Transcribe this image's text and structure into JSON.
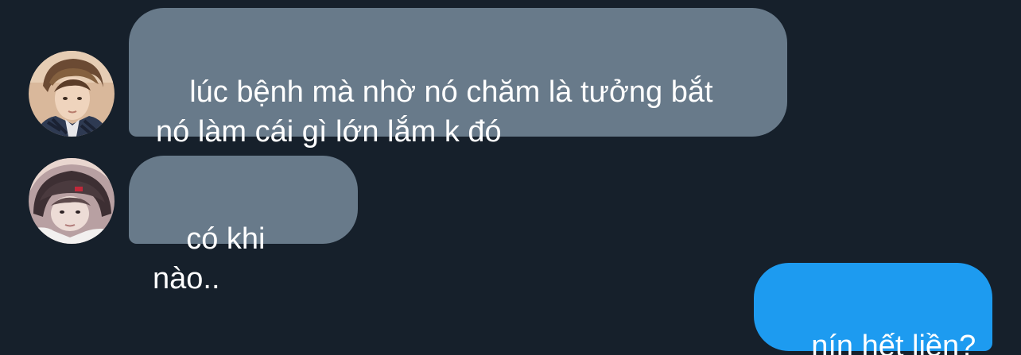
{
  "conversation": {
    "messages": [
      {
        "direction": "incoming",
        "avatar_icon": "avatar-photo-person-fluffy-hair",
        "text": "lúc bệnh mà nhờ nó chăm là tưởng bắt\nnó làm cái gì lớn lắm k đó"
      },
      {
        "direction": "incoming",
        "avatar_icon": "avatar-photo-person-hood-cap",
        "text": "có khi nào.."
      },
      {
        "direction": "outgoing",
        "text": "nín hết liền?"
      }
    ]
  },
  "colors": {
    "background": "#16202b",
    "incoming_bubble": "#687a8a",
    "outgoing_bubble": "#1d9bf0",
    "text": "#ffffff"
  }
}
